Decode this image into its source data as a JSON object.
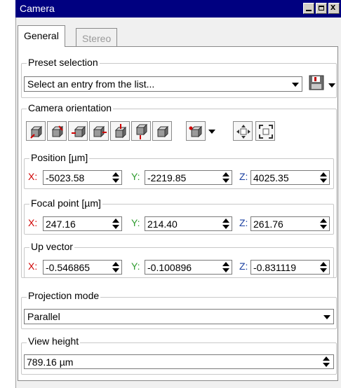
{
  "window": {
    "title": "Camera"
  },
  "tabs": [
    {
      "label": "General",
      "active": true
    },
    {
      "label": "Stereo",
      "active": false
    }
  ],
  "preset": {
    "group_label": "Preset selection",
    "combo_value": "Select an entry from the list...",
    "save_icon": "floppy-save-icon"
  },
  "orientation": {
    "group_label": "Camera orientation",
    "view_icons": [
      "cube-view-1-icon",
      "cube-view-2-icon",
      "cube-view-3-icon",
      "cube-view-4-icon",
      "cube-view-5-icon",
      "cube-view-6-icon",
      "cube-view-7-icon"
    ],
    "extra_icons": [
      "move-arrows-icon",
      "fit-view-icon"
    ],
    "position": {
      "label": "Position [µm]",
      "x_label": "X:",
      "y_label": "Y:",
      "z_label": "Z:",
      "x": "-5023.58",
      "y": "-2219.85",
      "z": "4025.35"
    },
    "focal": {
      "label": "Focal point [µm]",
      "x_label": "X:",
      "y_label": "Y:",
      "z_label": "Z:",
      "x": "247.16",
      "y": "214.40",
      "z": "261.76"
    },
    "up": {
      "label": "Up vector",
      "x_label": "X:",
      "y_label": "Y:",
      "z_label": "Z:",
      "x": "-0.546865",
      "y": "-0.100896",
      "z": "-0.831119"
    }
  },
  "projection": {
    "group_label": "Projection mode",
    "value": "Parallel"
  },
  "view_height": {
    "group_label": "View height",
    "value": "789.16 µm"
  },
  "colors": {
    "title_bar": "#000080",
    "x_axis": "#d00000",
    "y_axis": "#2e9b2e",
    "z_axis": "#1a3fa0"
  }
}
